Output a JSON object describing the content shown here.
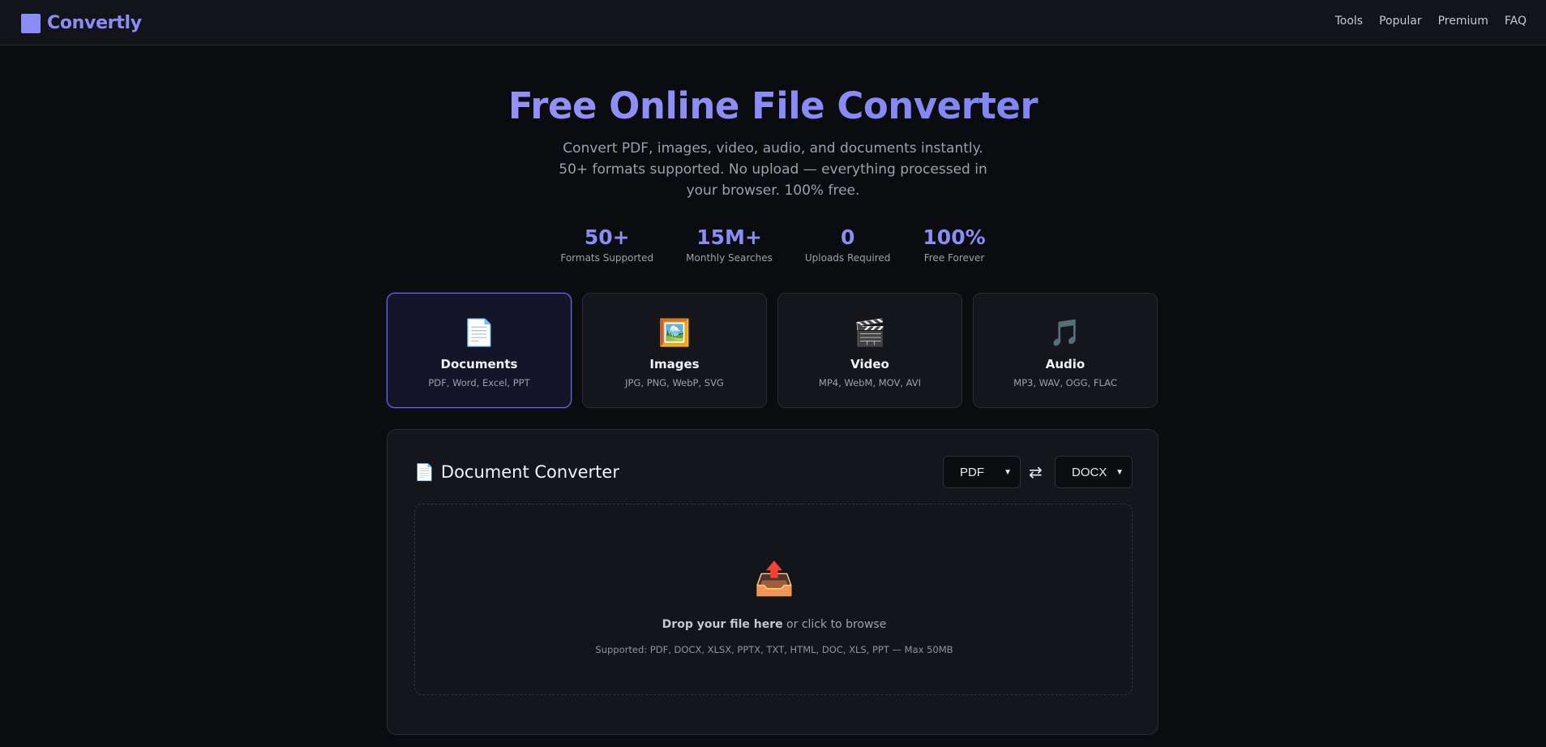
{
  "nav": {
    "brand": "Convertly",
    "links": [
      "Tools",
      "Popular",
      "Premium",
      "FAQ"
    ]
  },
  "hero": {
    "title": "Free Online File Converter",
    "subtitle": "Convert PDF, images, video, audio, and documents instantly. 50+ formats supported. No upload — everything processed in your browser. 100% free."
  },
  "stats": [
    {
      "value": "50+",
      "label": "Formats Supported"
    },
    {
      "value": "15M+",
      "label": "Monthly Searches"
    },
    {
      "value": "0",
      "label": "Uploads Required"
    },
    {
      "value": "100%",
      "label": "Free Forever"
    }
  ],
  "categories": [
    {
      "icon": "📄",
      "icon_name": "document-icon",
      "title": "Documents",
      "desc": "PDF, Word, Excel, PPT",
      "active": true
    },
    {
      "icon": "🖼️",
      "icon_name": "image-icon",
      "title": "Images",
      "desc": "JPG, PNG, WebP, SVG",
      "active": false
    },
    {
      "icon": "🎬",
      "icon_name": "clapper-icon",
      "title": "Video",
      "desc": "MP4, WebM, MOV, AVI",
      "active": false
    },
    {
      "icon": "🎵",
      "icon_name": "music-note-icon",
      "title": "Audio",
      "desc": "MP3, WAV, OGG, FLAC",
      "active": false
    }
  ],
  "converter": {
    "icon": "📄",
    "title": "Document Converter",
    "from_format": "PDF",
    "to_format": "DOCX",
    "swap_symbol": "⇄",
    "drop_icon": "📤",
    "drop_bold": "Drop your file here",
    "drop_rest": " or click to browse",
    "supported": "Supported: PDF, DOCX, XLSX, PPTX, TXT, HTML, DOC, XLS, PPT — Max 50MB"
  },
  "colors": {
    "accent": "#8b8df7",
    "background": "#0b0c0f",
    "card": "#15161c",
    "active_border": "#6a6cf0"
  }
}
